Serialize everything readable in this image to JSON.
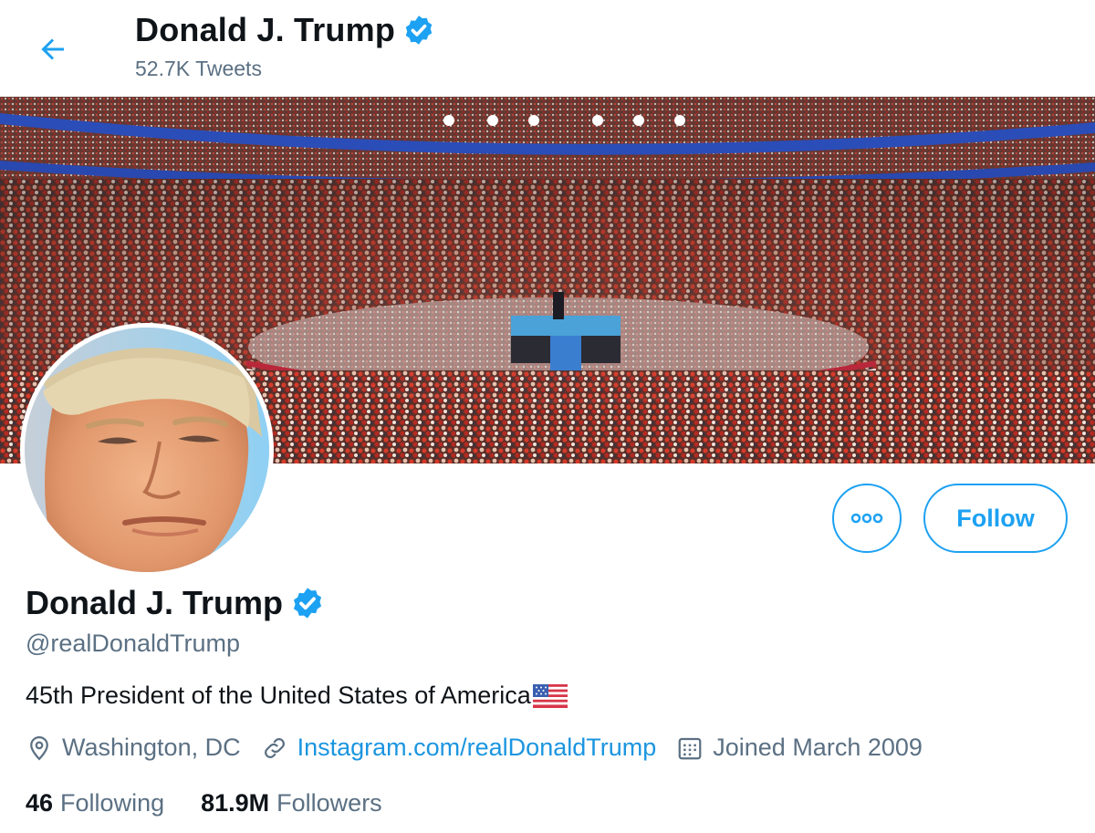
{
  "header": {
    "title": "Donald J. Trump",
    "tweet_count": "52.7K Tweets"
  },
  "profile": {
    "name": "Donald J. Trump",
    "handle": "@realDonaldTrump",
    "bio": "45th President of the United States of America",
    "location": "Washington, DC",
    "website": "Instagram.com/realDonaldTrump",
    "joined": "Joined March 2009",
    "following_count": "46",
    "following_label": "Following",
    "followers_count": "81.9M",
    "followers_label": "Followers"
  },
  "actions": {
    "follow_label": "Follow"
  },
  "icons": {
    "back": "arrow-left-icon",
    "verified": "verified-badge-icon",
    "more": "more-horizontal-icon",
    "location": "location-pin-icon",
    "link": "link-icon",
    "calendar": "calendar-icon",
    "flag": "us-flag-icon"
  },
  "colors": {
    "accent": "#1da1f2",
    "link": "#1b95e0",
    "secondary_text": "#5b7083",
    "primary_text": "#0f1419"
  }
}
